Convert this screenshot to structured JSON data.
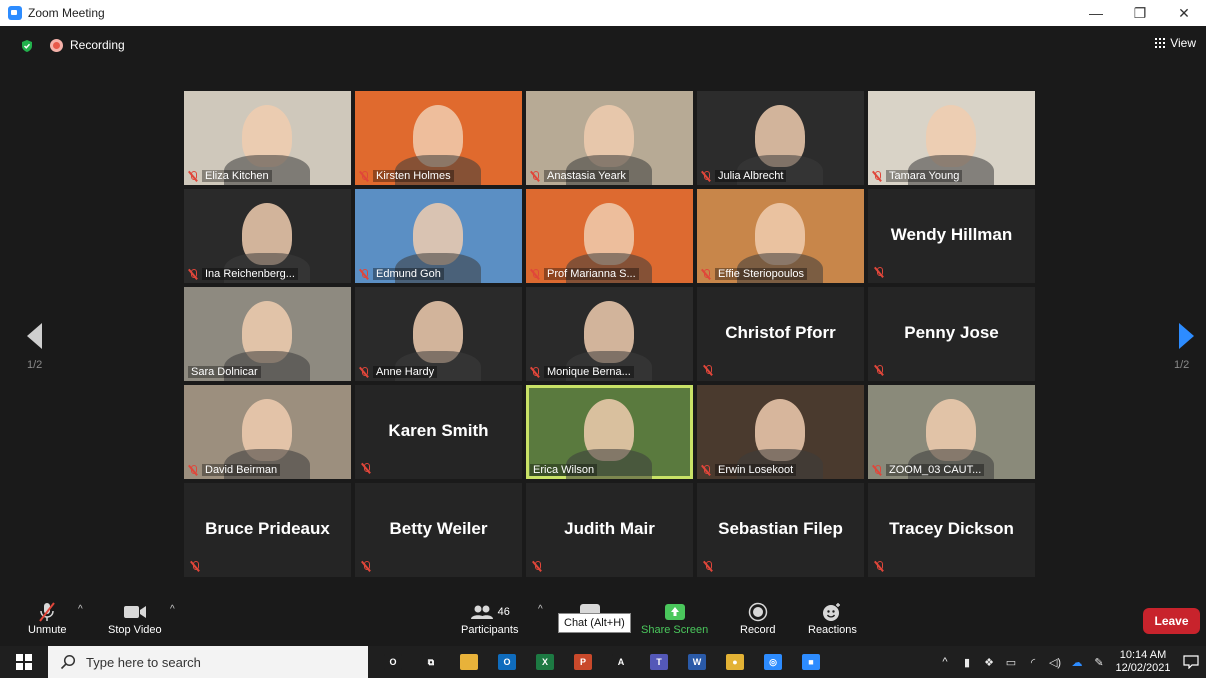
{
  "window": {
    "title": "Zoom Meeting",
    "minimize": "—",
    "restore": "❐",
    "close": "✕"
  },
  "meeting_header": {
    "recording_label": "Recording",
    "view_label": "View"
  },
  "pagination": {
    "left": "1/2",
    "right": "1/2"
  },
  "participants": [
    {
      "name": "Eliza Kitchen",
      "video": true,
      "muted": true,
      "bg": "#cfc8bb"
    },
    {
      "name": "Kirsten Holmes",
      "video": true,
      "muted": true,
      "bg": "#e06a2e"
    },
    {
      "name": "Anastasia Yeark",
      "video": true,
      "muted": true,
      "bg": "#b7aa95"
    },
    {
      "name": "Julia Albrecht",
      "video": true,
      "muted": true,
      "bg": "#2c2c2c"
    },
    {
      "name": "Tamara Young",
      "video": true,
      "muted": true,
      "bg": "#d9d3c7"
    },
    {
      "name": "Ina Reichenberg...",
      "video": true,
      "muted": true,
      "bg": "#2a2a2a"
    },
    {
      "name": "Edmund Goh",
      "video": true,
      "muted": true,
      "bg": "#5b8fc4"
    },
    {
      "name": "Prof Marianna S...",
      "video": true,
      "muted": true,
      "bg": "#dd6a30"
    },
    {
      "name": "Effie Steriopoulos",
      "video": true,
      "muted": true,
      "bg": "#c8864a"
    },
    {
      "name": "Wendy Hillman",
      "video": false,
      "muted": true,
      "bg": "#252525"
    },
    {
      "name": "Sara Dolnicar",
      "video": true,
      "muted": false,
      "bg": "#8e8a80"
    },
    {
      "name": "Anne Hardy",
      "video": true,
      "muted": true,
      "bg": "#2a2a2a"
    },
    {
      "name": "Monique Berna...",
      "video": true,
      "muted": true,
      "bg": "#2a2a2a"
    },
    {
      "name": "Christof Pforr",
      "video": false,
      "muted": true,
      "bg": "#252525"
    },
    {
      "name": "Penny Jose",
      "video": false,
      "muted": true,
      "bg": "#252525"
    },
    {
      "name": "David Beirman",
      "video": true,
      "muted": true,
      "bg": "#9c8f7e"
    },
    {
      "name": "Karen Smith",
      "video": false,
      "muted": true,
      "bg": "#252525"
    },
    {
      "name": "Erica Wilson",
      "video": true,
      "muted": false,
      "bg": "#5a7a3e",
      "active": true
    },
    {
      "name": "Erwin Losekoot",
      "video": true,
      "muted": true,
      "bg": "#4a3a2e"
    },
    {
      "name": "ZOOM_03 CAUT...",
      "video": true,
      "muted": true,
      "bg": "#8a8a7a"
    },
    {
      "name": "Bruce Prideaux",
      "video": false,
      "muted": true,
      "bg": "#252525"
    },
    {
      "name": "Betty Weiler",
      "video": false,
      "muted": true,
      "bg": "#252525"
    },
    {
      "name": "Judith Mair",
      "video": false,
      "muted": true,
      "bg": "#252525"
    },
    {
      "name": "Sebastian Filep",
      "video": false,
      "muted": true,
      "bg": "#252525"
    },
    {
      "name": "Tracey Dickson",
      "video": false,
      "muted": true,
      "bg": "#252525"
    }
  ],
  "toolbar": {
    "unmute": "Unmute",
    "stop_video": "Stop Video",
    "participants": "Participants",
    "participants_count": "46",
    "chat": "Chat",
    "chat_tooltip": "Chat (Alt+H)",
    "share_screen": "Share Screen",
    "record": "Record",
    "reactions": "Reactions",
    "leave": "Leave",
    "caret": "^"
  },
  "taskbar": {
    "search_placeholder": "Type here to search",
    "time": "10:14 AM",
    "date": "12/02/2021",
    "apps": [
      {
        "name": "cortana-icon",
        "color": "#1f1f1f",
        "glyph": "O"
      },
      {
        "name": "task-view-icon",
        "color": "#1f1f1f",
        "glyph": "⧉"
      },
      {
        "name": "file-explorer-icon",
        "color": "#e8b23a",
        "glyph": ""
      },
      {
        "name": "outlook-icon",
        "color": "#0f6cbd",
        "glyph": "O"
      },
      {
        "name": "excel-icon",
        "color": "#1d7a43",
        "glyph": "X"
      },
      {
        "name": "powerpoint-icon",
        "color": "#c9492b",
        "glyph": "P"
      },
      {
        "name": "acrobat-icon",
        "color": "#1f1f1f",
        "glyph": "A"
      },
      {
        "name": "teams-icon",
        "color": "#5458b8",
        "glyph": "T"
      },
      {
        "name": "word-icon",
        "color": "#2a5aa8",
        "glyph": "W"
      },
      {
        "name": "chrome-icon",
        "color": "#e3b235",
        "glyph": "●"
      },
      {
        "name": "network-app-icon",
        "color": "#2d8cff",
        "glyph": "◎"
      },
      {
        "name": "zoom-taskbar-icon",
        "color": "#2d8cff",
        "glyph": "■"
      }
    ]
  }
}
